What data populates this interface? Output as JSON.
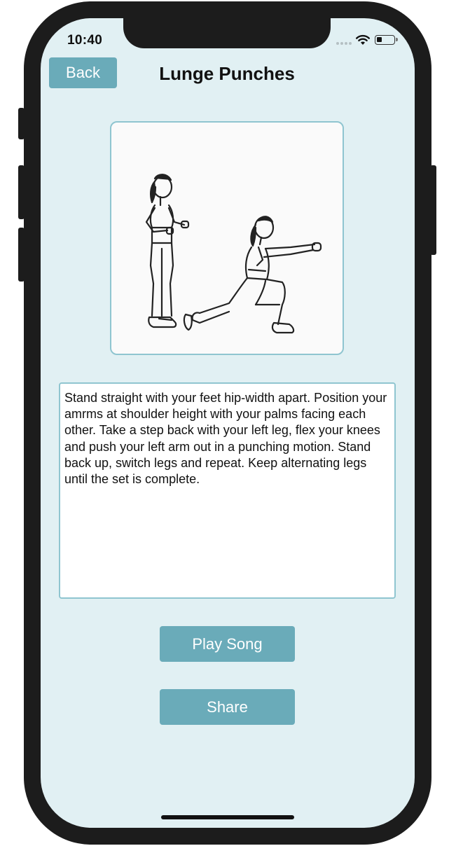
{
  "status_bar": {
    "time": "10:40",
    "icons": [
      "cellular-signal-icon",
      "wifi-icon",
      "battery-icon"
    ]
  },
  "nav": {
    "back_label": "Back",
    "title": "Lunge Punches"
  },
  "exercise_image": {
    "icon": "lunge-punch-illustration"
  },
  "description": {
    "text": "Stand straight with your feet hip-width apart. Position your amrms at shoulder height with your palms facing each other. Take a step back with your left leg, flex your knees and push your left arm out in a punching motion. Stand back up, switch legs and repeat. Keep alternating legs until the set is complete."
  },
  "actions": {
    "play_label": "Play Song",
    "share_label": "Share"
  },
  "colors": {
    "accent": "#6aabb9",
    "screen_background": "#e1f0f3",
    "frame_border": "#8fc5d0"
  }
}
